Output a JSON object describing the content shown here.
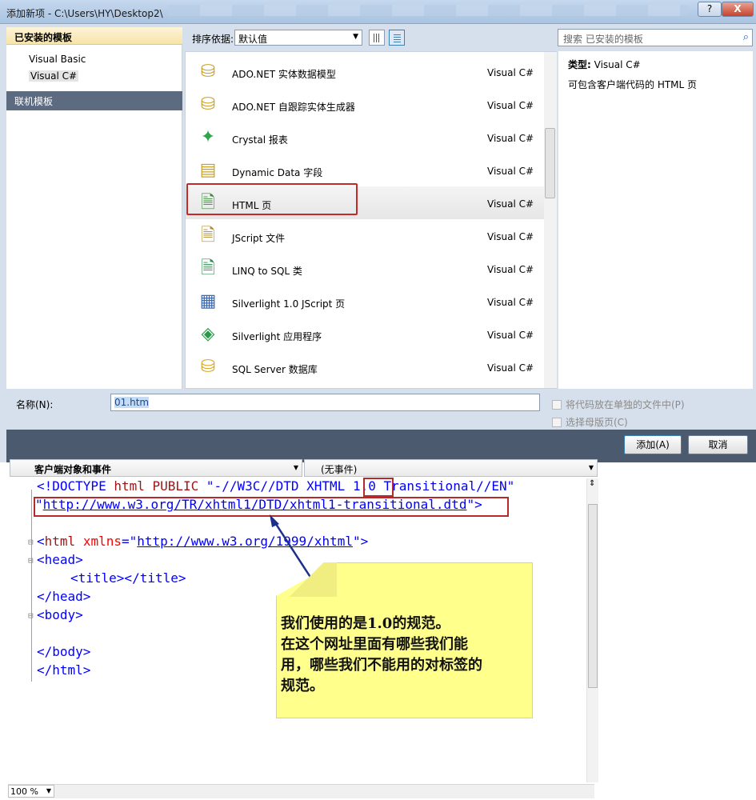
{
  "window": {
    "title": "添加新项 - C:\\Users\\HY\\Desktop2\\",
    "help": "?",
    "close": "X"
  },
  "leftpane": {
    "header": "已安装的模板",
    "items": [
      "Visual Basic",
      "Visual C#"
    ],
    "online": "联机模板"
  },
  "toolbar": {
    "sort_label": "排序依据:",
    "sort_value": "默认值"
  },
  "search": {
    "placeholder": "搜索 已安装的模板"
  },
  "templates": [
    {
      "name": "ADO.NET 实体数据模型",
      "lang": "Visual C#",
      "icon": "database-model-icon"
    },
    {
      "name": "ADO.NET 自跟踪实体生成器",
      "lang": "Visual C#",
      "icon": "database-generator-icon"
    },
    {
      "name": "Crystal 报表",
      "lang": "Visual C#",
      "icon": "crystal-report-icon"
    },
    {
      "name": "Dynamic Data 字段",
      "lang": "Visual C#",
      "icon": "dynamic-data-icon"
    },
    {
      "name": "HTML 页",
      "lang": "Visual C#",
      "icon": "html-page-icon"
    },
    {
      "name": "JScript 文件",
      "lang": "Visual C#",
      "icon": "jscript-file-icon"
    },
    {
      "name": "LINQ to SQL 类",
      "lang": "Visual C#",
      "icon": "linq-sql-icon"
    },
    {
      "name": "Silverlight 1.0 JScript 页",
      "lang": "Visual C#",
      "icon": "silverlight-page-icon"
    },
    {
      "name": "Silverlight 应用程序",
      "lang": "Visual C#",
      "icon": "silverlight-app-icon"
    },
    {
      "name": "SQL Server 数据库",
      "lang": "Visual C#",
      "icon": "sql-database-icon"
    }
  ],
  "details": {
    "type_label": "类型:",
    "type_value": "Visual C#",
    "description": "可包含客户端代码的 HTML 页"
  },
  "name_field": {
    "label": "名称(N):",
    "value": "01.htm"
  },
  "options": {
    "separate": "将代码放在单独的文件中(P)",
    "master": "选择母版页(C)"
  },
  "buttons": {
    "add": "添加(A)",
    "cancel": "取消"
  },
  "editor": {
    "combo_left": "客户端对象和事件",
    "combo_right": "(无事件)",
    "lines": {
      "l1a": "<!DOCTYPE ",
      "l1b": "html PUBLIC ",
      "l1c": "\"-//W3C//DTD XHTML ",
      "l1d": "1.0",
      "l1e": " Transitional//EN\"",
      "l2a": "\"",
      "l2b": "http://www.w3.org/TR/xhtml1/DTD/xhtml1-transitional.dtd",
      "l2c": "\">",
      "l3a": "<",
      "l3b": "html ",
      "l3c": "xmlns",
      "l3d": "=\"",
      "l3e": "http://www.w3.org/1999/xhtml",
      "l3f": "\">",
      "l4": "<head>",
      "l5": "<title></title>",
      "l6": "</head>",
      "l7": "<body>",
      "l8": "</body>",
      "l9": "</html>"
    },
    "zoom": "100 %"
  },
  "note": {
    "line1": "我们使用的是1.0的规范。",
    "line2": "在这个网址里面有哪些我们能",
    "line3": "用，哪些我们不能用的对标签的",
    "line4": "规范。"
  }
}
